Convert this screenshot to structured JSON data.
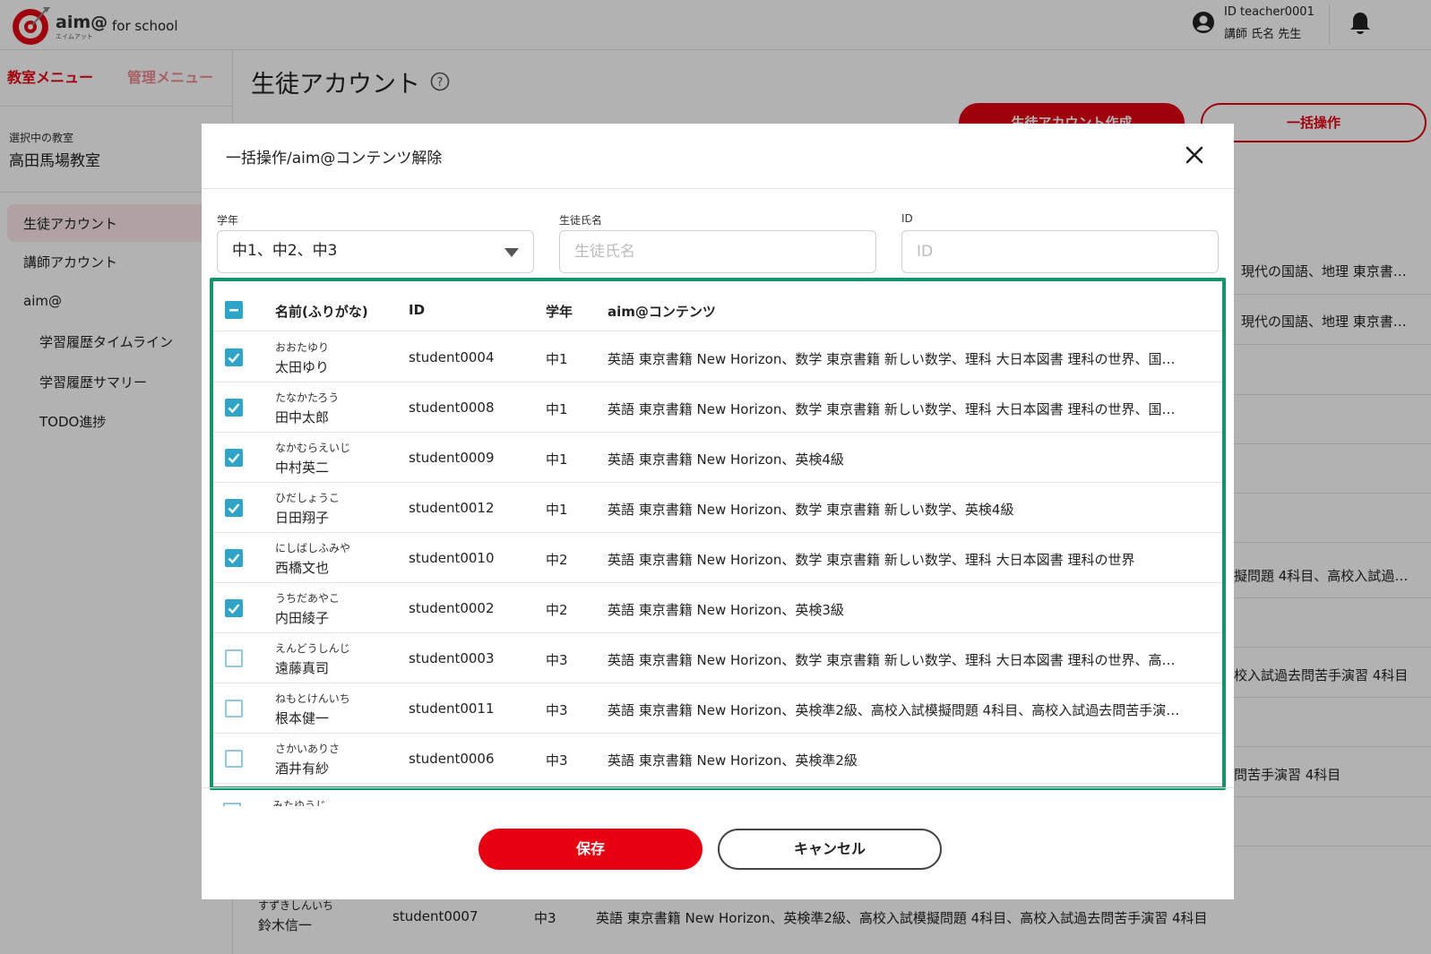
{
  "brand": {
    "logo_word": "aim@",
    "logo_kana": "エイムアット",
    "school": "for school",
    "accent": "#e60012"
  },
  "user": {
    "id_line": "ID teacher0001",
    "name_line": "講師 氏名 先生"
  },
  "sidebar": {
    "tabs": [
      "教室メニュー",
      "管理メニュー"
    ],
    "selected_label": "選択中の教室",
    "selected_name": "高田馬場教室",
    "items": [
      "生徒アカウント",
      "講師アカウント",
      "aim@",
      "学習履歴タイムライン",
      "学習履歴サマリー",
      "TODO進捗"
    ]
  },
  "page": {
    "title": "生徒アカウント",
    "create_button": "生徒アカウント作成",
    "bulk_button": "一括操作",
    "bg_rows": [
      "、現代の国語、地理 東京書…",
      "、現代の国語、地理 東京書…",
      "擬問題 4科目、高校入試過…",
      "校入試過去問苦手演習 4科目",
      "問苦手演習 4科目"
    ],
    "bg_last": {
      "kana": "すずきしんいち",
      "kanji": "鈴木信一",
      "id": "student0007",
      "grade": "中3",
      "content": "英語 東京書籍 New Horizon、英検準2級、高校入試模擬問題 4科目、高校入試過去問苦手演習 4科目"
    }
  },
  "modal": {
    "title": "一括操作/aim@コンテンツ解除",
    "filters": {
      "grade_label": "学年",
      "grade_value": "中1、中2、中3",
      "name_label": "生徒氏名",
      "name_placeholder": "生徒氏名",
      "id_label": "ID",
      "id_placeholder": "ID"
    },
    "columns": [
      "名前(ふりがな)",
      "ID",
      "学年",
      "aim@コンテンツ"
    ],
    "rows": [
      {
        "checked": true,
        "kana": "おおたゆり",
        "kanji": "太田ゆり",
        "id": "student0004",
        "grade": "中1",
        "content": "英語 東京書籍 New Horizon、数学 東京書籍 新しい数学、理科 大日本図書 理科の世界、国…"
      },
      {
        "checked": true,
        "kana": "たなかたろう",
        "kanji": "田中太郎",
        "id": "student0008",
        "grade": "中1",
        "content": "英語 東京書籍 New Horizon、数学 東京書籍 新しい数学、理科 大日本図書 理科の世界、国…"
      },
      {
        "checked": true,
        "kana": "なかむらえいじ",
        "kanji": "中村英二",
        "id": "student0009",
        "grade": "中1",
        "content": "英語 東京書籍 New Horizon、英検4級"
      },
      {
        "checked": true,
        "kana": "ひだしょうこ",
        "kanji": "日田翔子",
        "id": "student0012",
        "grade": "中1",
        "content": "英語 東京書籍 New Horizon、数学 東京書籍 新しい数学、英検4級"
      },
      {
        "checked": true,
        "kana": "にしばしふみや",
        "kanji": "西橋文也",
        "id": "student0010",
        "grade": "中2",
        "content": "英語 東京書籍 New Horizon、数学 東京書籍 新しい数学、理科 大日本図書 理科の世界"
      },
      {
        "checked": true,
        "kana": "うちだあやこ",
        "kanji": "内田綾子",
        "id": "student0002",
        "grade": "中2",
        "content": "英語 東京書籍 New Horizon、英検3級"
      },
      {
        "checked": false,
        "kana": "えんどうしんじ",
        "kanji": "遠藤真司",
        "id": "student0003",
        "grade": "中3",
        "content": "英語 東京書籍 New Horizon、数学 東京書籍 新しい数学、理科 大日本図書 理科の世界、高…"
      },
      {
        "checked": false,
        "kana": "ねもとけんいち",
        "kanji": "根本健一",
        "id": "student0011",
        "grade": "中3",
        "content": "英語 東京書籍 New Horizon、英検準2級、高校入試模擬問題 4科目、高校入試過去問苦手演…"
      },
      {
        "checked": false,
        "kana": "さかいありさ",
        "kanji": "酒井有紗",
        "id": "student0006",
        "grade": "中3",
        "content": "英語 東京書籍 New Horizon、英検準2級"
      }
    ],
    "peek_kana": "みたゆうじ",
    "save": "保存",
    "cancel": "キャンセル",
    "frame_color": "#16936a"
  }
}
